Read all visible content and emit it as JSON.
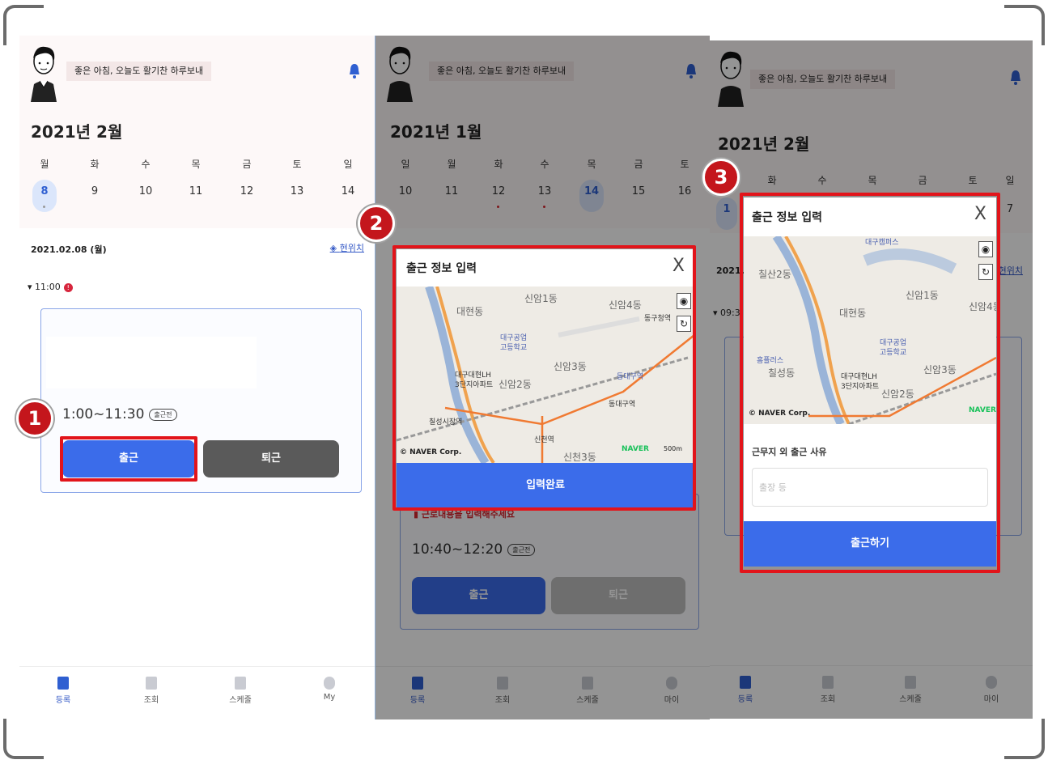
{
  "greeting": "좋은 아침, 오늘도 활기찬 하루보내",
  "weekdays_mon": [
    "월",
    "화",
    "수",
    "목",
    "금",
    "토",
    "일"
  ],
  "screens": {
    "s1": {
      "month": "2021년 2월",
      "days": [
        "8",
        "9",
        "10",
        "11",
        "12",
        "13",
        "14"
      ],
      "selected_date": "2021.02.08 (월)",
      "location_link": "현위치",
      "time_group": "11:00",
      "shift_time": "1:00~11:30",
      "status_badge": "출근전",
      "clock_in": "출근",
      "clock_out": "퇴근"
    },
    "s2": {
      "month": "2021년 1월",
      "weekdays": [
        "일",
        "월",
        "화",
        "수",
        "목",
        "금",
        "토"
      ],
      "days": [
        "10",
        "11",
        "12",
        "13",
        "14",
        "15",
        "16"
      ],
      "modal_title": "출근 정보 입력",
      "close": "X",
      "map_labels": {
        "a": "신암1동",
        "b": "대현동",
        "c": "신암4동",
        "d": "동구청역",
        "e": "대구공업",
        "e2": "고등학교",
        "f": "신암3동",
        "g": "대구대현LH",
        "g2": "3단지아파트",
        "h": "신암2동",
        "i": "동대구역",
        "j": "동대구역",
        "k": "칠성시장역",
        "l": "신천역",
        "m": "신천3동"
      },
      "map_copyright": "© NAVER Corp.",
      "map_logo": "NAVER",
      "map_scale": "500m",
      "submit": "입력완료",
      "warning": "근로내용을 입력해주세요",
      "shift_time": "10:40~12:20",
      "status_badge": "출근전",
      "clock_in": "출근",
      "clock_out": "퇴근"
    },
    "s3": {
      "month": "2021년 2월",
      "modal_title": "출근 정보 입력",
      "close": "X",
      "partial": {
        "day_left": "1",
        "day_right": "7",
        "date": "2021.0",
        "time": "▾ 09:3",
        "loc": "현위치"
      },
      "map_labels": {
        "a": "칠산2동",
        "b": "신암1동",
        "c": "신암4동",
        "d": "대현동",
        "e": "대구공업",
        "e2": "고등학교",
        "f": "홈플러스",
        "f2": "칠성동",
        "g": "대구대현LH",
        "g2": "3단지아파트",
        "h": "신암2동",
        "i": "신암3동",
        "j": "대구캠퍼스"
      },
      "map_copyright": "© NAVER Corp.",
      "map_logo": "NAVER",
      "reason_label": "근무지 외 출근 사유",
      "reason_placeholder": "출장 등",
      "submit": "출근하기"
    }
  },
  "nav": {
    "register": "등록",
    "lookup": "조회",
    "schedule": "스케줄",
    "my": "My",
    "my_kr": "마이"
  },
  "steps": [
    "1",
    "2",
    "3"
  ],
  "colors": {
    "accent": "#3b6cea",
    "highlight": "#e2141a",
    "step": "#c4161c"
  }
}
